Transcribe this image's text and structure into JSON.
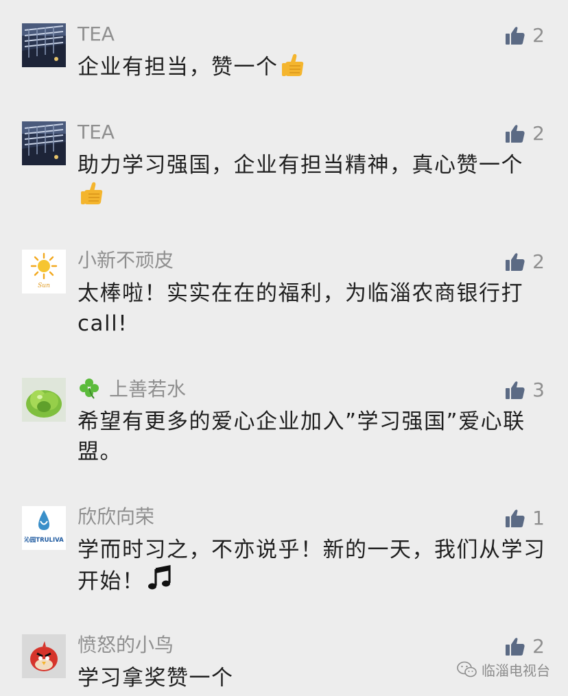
{
  "comments": [
    {
      "nick": "TEA",
      "text": "企业有担当，赞一个",
      "likes": "2"
    },
    {
      "nick": "TEA",
      "text": "助力学习强国，企业有担当精神，真心赞一个",
      "likes": "2"
    },
    {
      "nick": "小新不顽皮",
      "text": "太棒啦！实实在在的福利，为临淄农商银行打call!",
      "likes": "2",
      "avatar_label": "Sun"
    },
    {
      "nick": "上善若水",
      "text": "希望有更多的爱心企业加入”学习强国”爱心联盟。",
      "likes": "3"
    },
    {
      "nick": "欣欣向荣",
      "text": "学而时习之，不亦说乎！新的一天，我们从学习开始！",
      "likes": "1",
      "avatar_label": "沁园TRULIVA"
    },
    {
      "nick": "愤怒的小鸟",
      "text": "学习拿奖赞一个",
      "likes": "2"
    }
  ],
  "watermark": {
    "text": "临淄电视台"
  },
  "colors": {
    "background": "#ededed",
    "nick": "#8f8f8f",
    "text": "#1f1f1f",
    "thumb": "#5b6a84"
  },
  "icons": [
    "thumbs-up-icon",
    "thumbs-up-emoji",
    "clover-icon",
    "music-note-emoji",
    "wechat-icon"
  ]
}
